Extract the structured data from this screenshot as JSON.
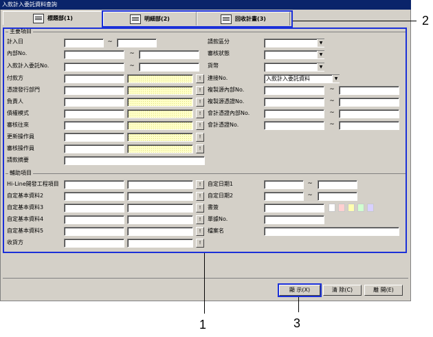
{
  "window": {
    "title": "入款計入委託資料查詢"
  },
  "tabs": [
    {
      "label": "標題部(1)",
      "icon": "book-icon"
    },
    {
      "label": "明細部(2)",
      "icon": "document-icon"
    },
    {
      "label": "回收計畫(3)",
      "icon": "schedule-icon"
    }
  ],
  "main_section": {
    "title": "主要項目",
    "left_rows": [
      {
        "label": "計入日",
        "value": ""
      },
      {
        "label": "內部No.",
        "value": ""
      },
      {
        "label": "入款計入委託No.",
        "value": ""
      },
      {
        "label": "付款方"
      },
      {
        "label": "憑證發行部門"
      },
      {
        "label": "負責人"
      },
      {
        "label": "債權模式"
      },
      {
        "label": "審核往來"
      },
      {
        "label": "更新操作員"
      },
      {
        "label": "審核操作員"
      },
      {
        "label": "請款摘要"
      }
    ],
    "right_rows": [
      {
        "label": "請款區分"
      },
      {
        "label": "審核狀態"
      },
      {
        "label": "貨幣"
      },
      {
        "label": "連接No.",
        "value": "入款計入委託資料"
      },
      {
        "label": "複製源內部No."
      },
      {
        "label": "複製源憑證No."
      },
      {
        "label": "會計憑證內部No."
      },
      {
        "label": "會計憑證No."
      }
    ]
  },
  "aux_section": {
    "title": "輔助項目",
    "left_rows": [
      {
        "label": "Hi-Line開發工程項目"
      },
      {
        "label": "自定基本資料2"
      },
      {
        "label": "自定基本資料3"
      },
      {
        "label": "自定基本資料4"
      },
      {
        "label": "自定基本資料5"
      },
      {
        "label": "收貨方"
      }
    ],
    "right_rows": [
      {
        "label": "自定日期1"
      },
      {
        "label": "自定日期2"
      },
      {
        "label": "書簽"
      },
      {
        "label": "單據No."
      },
      {
        "label": "檔案名"
      }
    ]
  },
  "common": {
    "tilde": "~",
    "lookup": "!"
  },
  "buttons": {
    "display": "顯 示(X)",
    "clear": "清 除(C)",
    "exit": "離 開(E)"
  },
  "callouts": [
    "1",
    "2",
    "3"
  ],
  "colors": {
    "callout": "#1a2fd8",
    "field_yellow": "#ffffc8",
    "title_bar": "#0a246a"
  }
}
